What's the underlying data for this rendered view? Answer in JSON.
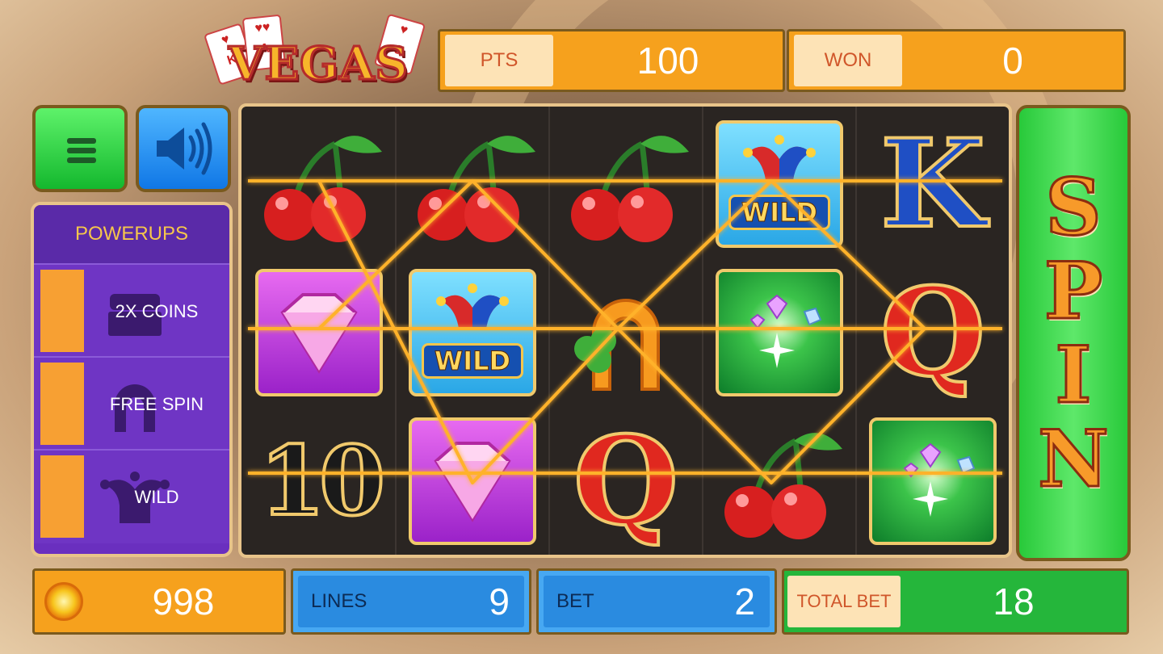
{
  "app": {
    "logo_text": "VEGAS"
  },
  "stats": {
    "pts_label": "PTS",
    "pts_value": "100",
    "won_label": "WON",
    "won_value": "0"
  },
  "buttons": {
    "menu_icon": "hamburger-icon",
    "sound_icon": "speaker-icon"
  },
  "powerups": {
    "title": "POWERUPS",
    "items": [
      {
        "label": "2X COINS",
        "icon": "treasure-chest-icon"
      },
      {
        "label": "FREE SPIN",
        "icon": "horseshoe-icon"
      },
      {
        "label": "WILD",
        "icon": "jester-hat-icon"
      }
    ]
  },
  "reels": [
    [
      "cherry",
      "gem",
      "ten"
    ],
    [
      "cherry",
      "wild",
      "gem"
    ],
    [
      "cherry",
      "horseshoe",
      "queen"
    ],
    [
      "wild",
      "green-gems",
      "cherry"
    ],
    [
      "king",
      "queen",
      "green-gems"
    ]
  ],
  "symbols": {
    "ten": "10",
    "queen": "Q",
    "king": "K",
    "wild": "WILD"
  },
  "spin": {
    "letters": [
      "S",
      "P",
      "I",
      "N"
    ]
  },
  "bottom": {
    "coins_value": "998",
    "lines_label": "LINES",
    "lines_value": "9",
    "bet_label": "BET",
    "bet_value": "2",
    "total_label": "TOTAL BET",
    "total_value": "18"
  },
  "colors": {
    "accent_orange": "#f6a11d",
    "panel_purple": "#6a2fbf",
    "spin_green": "#28c93a",
    "payline": "#ffb22a"
  }
}
